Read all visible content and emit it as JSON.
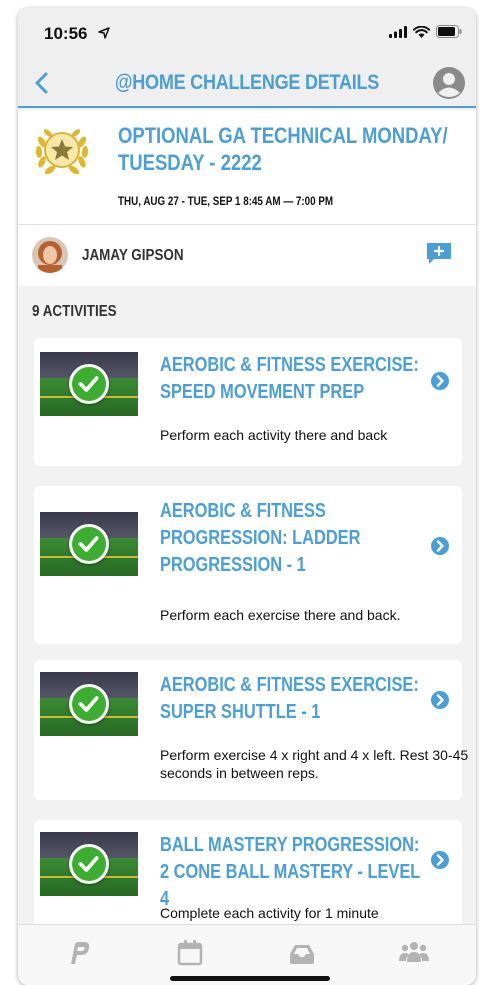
{
  "status_bar": {
    "time": "10:56"
  },
  "nav": {
    "title": "@HOME CHALLENGE DETAILS"
  },
  "challenge": {
    "title": "OPTIONAL GA TECHNICAL MONDAY/ TUESDAY - 2222",
    "date_range": "THU, AUG 27 - TUE, SEP 1 8:45 AM — 7:00 PM"
  },
  "coach": {
    "name": "JAMAY GIPSON"
  },
  "activities_label": "9 ACTIVITIES",
  "activities": [
    {
      "title": "AEROBIC & FITNESS EXERCISE: SPEED MOVEMENT PREP",
      "description": "Perform each activity there and back",
      "completed": true
    },
    {
      "title": "AEROBIC & FITNESS PROGRESSION: LADDER PROGRESSION - 1",
      "description": "Perform each exercise there and back.",
      "completed": true
    },
    {
      "title": "AEROBIC & FITNESS EXERCISE: SUPER SHUTTLE - 1",
      "description": "Perform exercise 4 x right and 4 x left. Rest 30-45 seconds in between reps.",
      "completed": true
    },
    {
      "title": "BALL MASTERY PROGRESSION: 2 CONE BALL MASTERY - LEVEL 4",
      "description": "Complete each activity for 1 minute",
      "completed": true
    }
  ],
  "tabs": [
    {
      "icon": "logo-icon"
    },
    {
      "icon": "calendar-icon"
    },
    {
      "icon": "inbox-icon"
    },
    {
      "icon": "team-icon"
    }
  ],
  "colors": {
    "accent": "#4a9fd8",
    "check": "#3cae2f",
    "icon_gray": "#b3b3b3"
  }
}
